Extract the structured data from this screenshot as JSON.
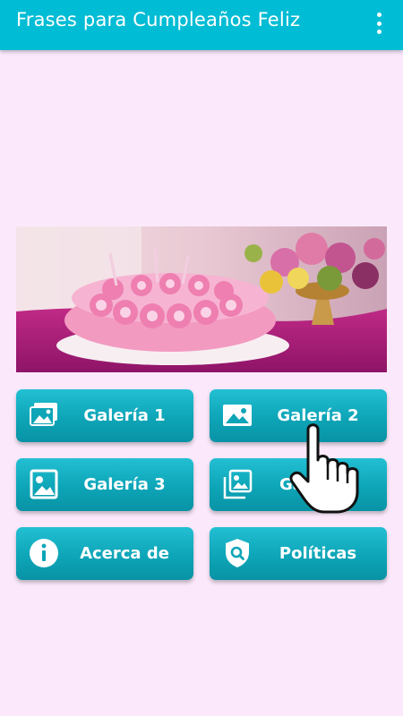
{
  "appbar": {
    "title": "Frases para Cumpleaños Feliz",
    "overflow_icon": "more-vert-icon"
  },
  "banner": {
    "image": "birthday-cake-photo"
  },
  "menu": [
    {
      "label": "Galería 1",
      "icon": "photo-stack-icon"
    },
    {
      "label": "Galería 2",
      "icon": "image-icon"
    },
    {
      "label": "Galería 3",
      "icon": "portrait-photo-icon"
    },
    {
      "label": "Ga",
      "icon": "photo-library-icon"
    },
    {
      "label": "Acerca de",
      "icon": "info-icon"
    },
    {
      "label": "Políticas",
      "icon": "shield-search-icon"
    }
  ],
  "colors": {
    "appbar": "#00bcd4",
    "background": "#fbe9fb",
    "button": "#0da5b7"
  }
}
